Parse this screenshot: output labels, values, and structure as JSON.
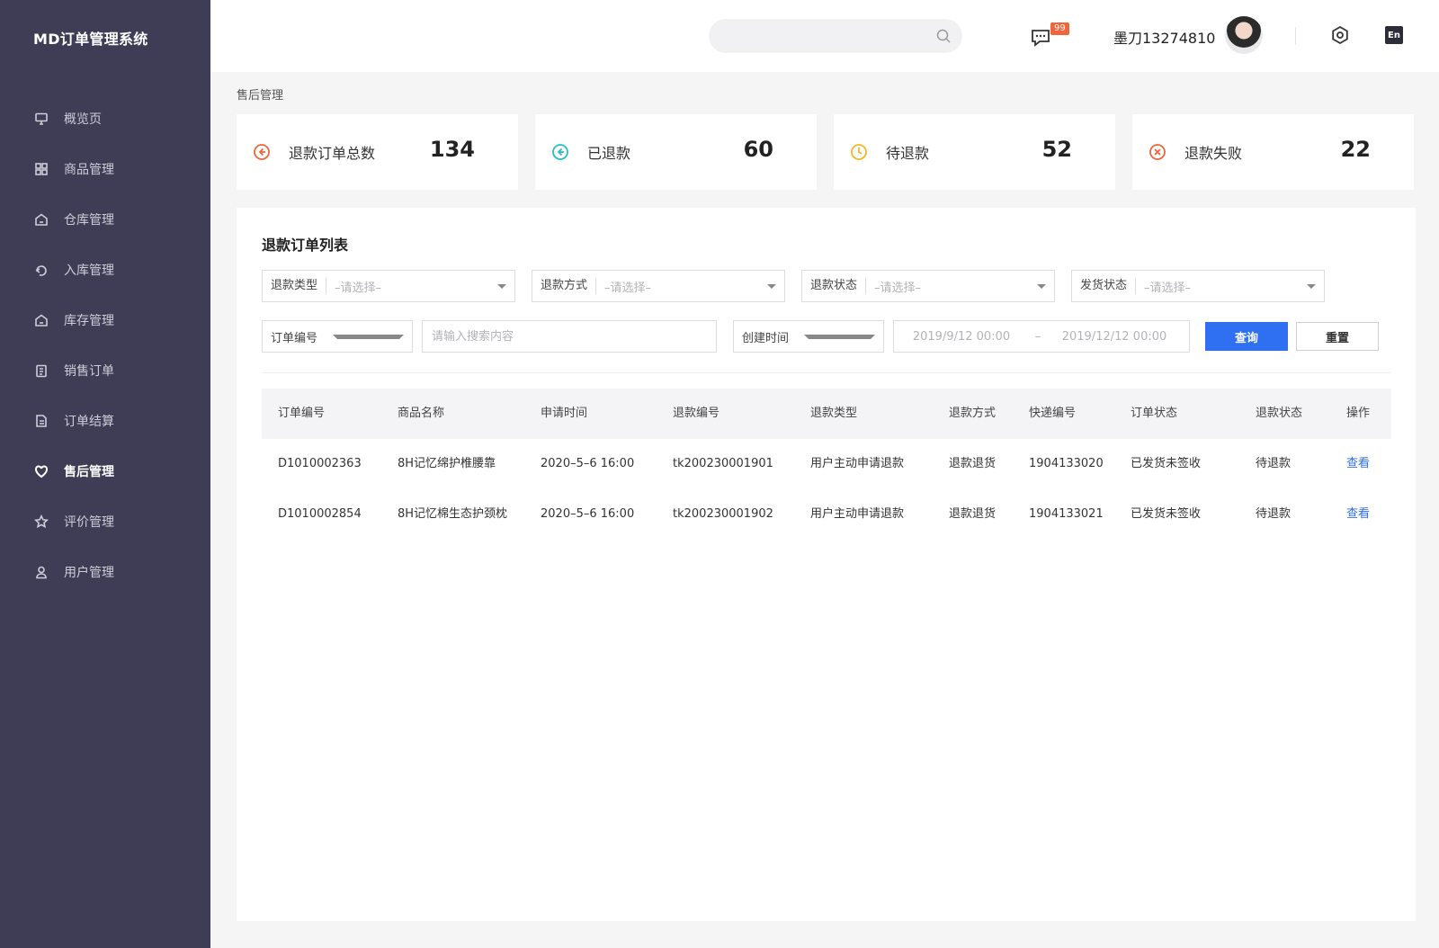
{
  "app": {
    "title": "MD订单管理系统"
  },
  "sidebar": {
    "items": [
      {
        "label": "概览页",
        "icon": "monitor-icon"
      },
      {
        "label": "商品管理",
        "icon": "grid-icon"
      },
      {
        "label": "仓库管理",
        "icon": "warehouse-icon"
      },
      {
        "label": "入库管理",
        "icon": "inbound-icon"
      },
      {
        "label": "库存管理",
        "icon": "stock-icon"
      },
      {
        "label": "销售订单",
        "icon": "clipboard-icon"
      },
      {
        "label": "订单结算",
        "icon": "settlement-icon"
      },
      {
        "label": "售后管理",
        "icon": "heart-icon",
        "active": true
      },
      {
        "label": "评价管理",
        "icon": "star-icon"
      },
      {
        "label": "用户管理",
        "icon": "user-icon"
      }
    ]
  },
  "header": {
    "search_placeholder": "",
    "message_badge": "99",
    "username": "墨刀13274810",
    "lang": "En"
  },
  "breadcrumb": "售后管理",
  "stats": [
    {
      "label": "退款订单总数",
      "value": "134",
      "color": "#f0663a",
      "icon": "back-arrow-icon"
    },
    {
      "label": "已退款",
      "value": "60",
      "color": "#23c0c7",
      "icon": "back-arrow-icon"
    },
    {
      "label": "待退款",
      "value": "52",
      "color": "#f5b722",
      "icon": "clock-icon"
    },
    {
      "label": "退款失败",
      "value": "22",
      "color": "#f0663a",
      "icon": "close-circle-icon"
    }
  ],
  "panel": {
    "title": "退款订单列表",
    "filters": {
      "refund_type": {
        "label": "退款类型",
        "value": "–请选择–"
      },
      "refund_method": {
        "label": "退款方式",
        "value": "–请选择–"
      },
      "refund_status": {
        "label": "退款状态",
        "value": "–请选择–"
      },
      "ship_status": {
        "label": "发货状态",
        "value": "–请选择–"
      },
      "order_field": "订单编号",
      "search_placeholder": "请输入搜索内容",
      "time_field": "创建时间",
      "date_from": "2019/9/12 00:00",
      "date_sep": "–",
      "date_to": "2019/12/12 00:00",
      "query_label": "查询",
      "reset_label": "重置"
    },
    "table": {
      "columns": [
        "订单编号",
        "商品名称",
        "申请时间",
        "退款编号",
        "退款类型",
        "退款方式",
        "快递编号",
        "订单状态",
        "退款状态",
        "操作"
      ],
      "rows": [
        [
          "D1010002363",
          "8H记忆绵护椎腰靠",
          "2020–5–6 16:00",
          "tk200230001901",
          "用户主动申请退款",
          "退款退货",
          "1904133020",
          "已发货未签收",
          "待退款",
          "查看"
        ],
        [
          "D1010002854",
          "8H记忆棉生态护颈枕",
          "2020–5–6 16:00",
          "tk200230001902",
          "用户主动申请退款",
          "退款退货",
          "1904133021",
          "已发货未签收",
          "待退款",
          "查看"
        ]
      ]
    }
  }
}
